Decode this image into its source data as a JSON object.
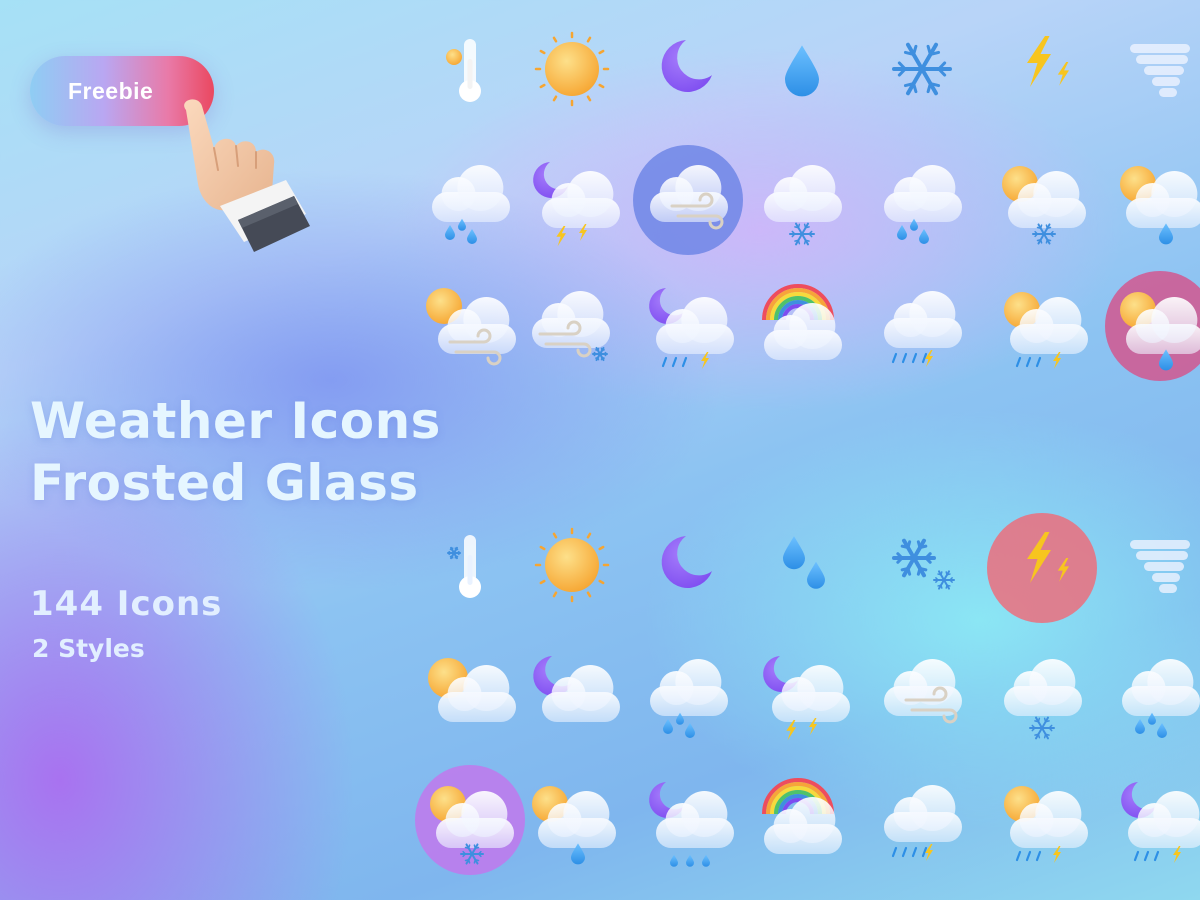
{
  "promo": {
    "freebie_label": "Freebie",
    "title_line1": "Weather Icons",
    "title_line2": "Frosted Glass",
    "icon_count": "144 Icons",
    "style_count": "2 Styles"
  },
  "colors": {
    "sun": "#f6a531",
    "moon": "#7d4cf0",
    "drop": "#2d8fe6",
    "snow": "#3f8fdf",
    "bolt": "#f7c51f",
    "cloud": "#eef4ff",
    "rainbow_red": "#ee4d5e",
    "highlight_indigo": "#6f86e6",
    "highlight_red": "#ec6f7c",
    "highlight_pink": "#d2578f",
    "highlight_purple": "#c178ec"
  },
  "icon_groups": [
    {
      "style": "style-1",
      "rows": [
        [
          "thermometer-hot-icon",
          "sun-icon",
          "moon-icon",
          "raindrop-icon",
          "snowflake-icon",
          "lightning-icon",
          "tornado-icon"
        ],
        [
          "cloud-rain-icon",
          "moon-cloud-storm-icon",
          "cloud-wind-icon",
          "cloud-snow-icon",
          "cloud-rain-icon",
          "sun-cloud-snow-icon",
          "sun-cloud-rain-icon"
        ],
        [
          "sun-cloud-wind-icon",
          "cloud-wind-snow-icon",
          "moon-cloud-rain-storm-icon",
          "rainbow-cloud-icon",
          "cloud-rain-storm-icon",
          "sun-cloud-rain-storm-icon",
          "sun-cloud-rain-icon"
        ]
      ]
    },
    {
      "style": "style-2",
      "rows": [
        [
          "thermometer-cold-icon",
          "sun-icon",
          "moon-icon",
          "raindrops-icon",
          "snowflakes-icon",
          "lightning-icon",
          "tornado-icon"
        ],
        [
          "sun-cloud-icon",
          "moon-cloud-icon",
          "cloud-rain-icon",
          "moon-cloud-storm-icon",
          "cloud-wind-icon",
          "cloud-snow-icon",
          "cloud-rain-icon"
        ],
        [
          "sun-cloud-snow-icon",
          "sun-cloud-rain-icon",
          "moon-cloud-rain-icon",
          "rainbow-cloud-icon",
          "cloud-rain-storm-icon",
          "sun-cloud-rain-storm-icon",
          "moon-cloud-rain-storm-icon"
        ]
      ]
    }
  ],
  "highlights": [
    {
      "group": 0,
      "row": 1,
      "col": 2,
      "color": "highlight_indigo"
    },
    {
      "group": 0,
      "row": 2,
      "col": 6,
      "color": "highlight_pink"
    },
    {
      "group": 1,
      "row": 0,
      "col": 5,
      "color": "highlight_red"
    },
    {
      "group": 1,
      "row": 2,
      "col": 0,
      "color": "highlight_purple"
    }
  ]
}
